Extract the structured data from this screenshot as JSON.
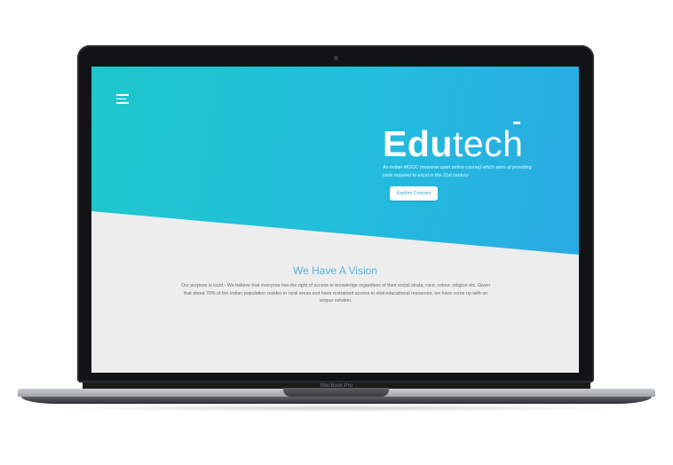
{
  "device": {
    "model_label": "MacBook Pro"
  },
  "hero": {
    "brand_part1": "Edu",
    "brand_part2": "tech",
    "tagline": "An Indian MOOC (massive open online course) which aims at providing tools required to excel in the 21st century",
    "cta_label": "Explore Courses",
    "menu_icon": "hamburger-menu-icon"
  },
  "vision": {
    "title": "We Have A Vision",
    "text": "Our purpose is lucid - We believe that everyone has the right of access to knowledge regardless of their social strata, race, colour, religion etc. Given that about 70% of the Indian population resides in rural areas and have restrained access to vital educational resources, we have come up with an unique solution."
  },
  "colors": {
    "hero_start": "#1ec7cc",
    "hero_end": "#2aa9e4",
    "vision_title": "#56b2dc",
    "page_background": "#ededed"
  }
}
